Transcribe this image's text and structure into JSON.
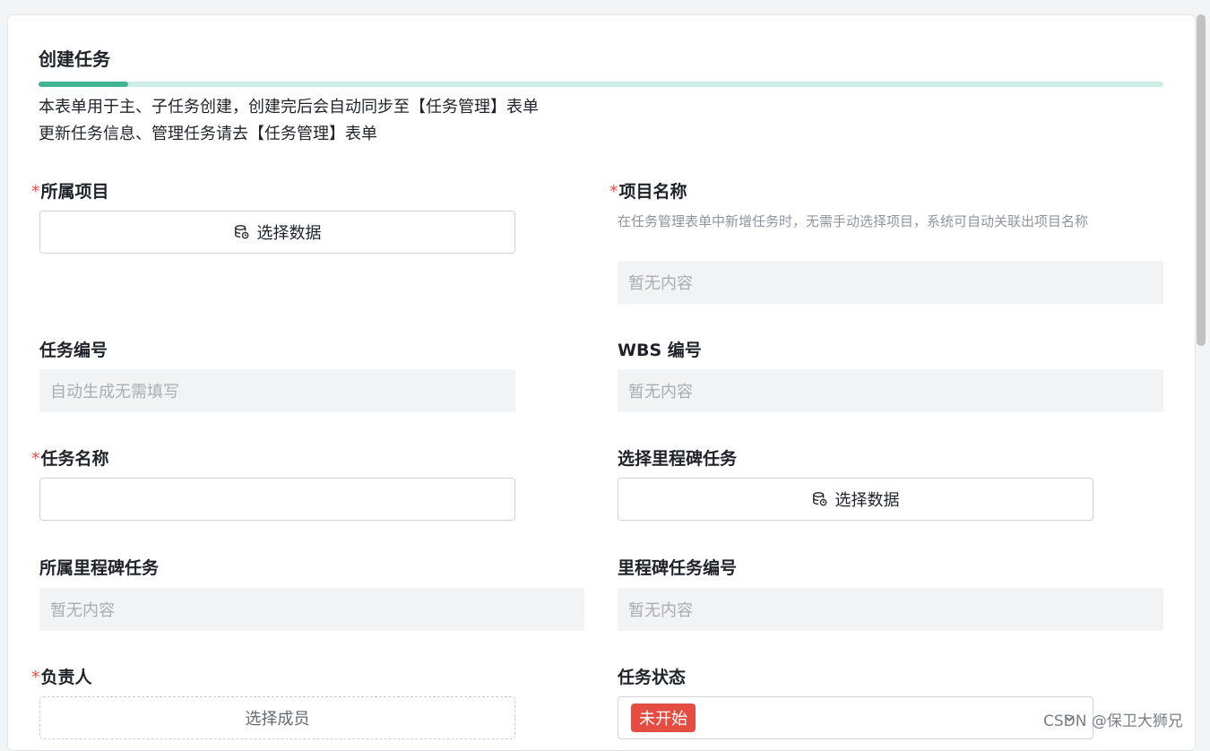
{
  "section": {
    "title": "创建任务",
    "progress_fraction": 0.08,
    "description_lines": [
      "本表单用于主、子任务创建，创建完后会自动同步至【任务管理】表单",
      "更新任务信息、管理任务请去【任务管理】表单"
    ]
  },
  "required_marker": "*",
  "fields": {
    "project": {
      "label": "所属项目",
      "button_label": "选择数据",
      "icon": "database-icon"
    },
    "project_name": {
      "label": "项目名称",
      "hint": "在任务管理表单中新增任务时，无需手动选择项目，系统可自动关联出项目名称",
      "value": "暂无内容"
    },
    "task_number": {
      "label": "任务编号",
      "value": "自动生成无需填写"
    },
    "wbs_number": {
      "label": "WBS 编号",
      "value": "暂无内容"
    },
    "task_name": {
      "label": "任务名称",
      "value": ""
    },
    "milestone_select": {
      "label": "选择里程碑任务",
      "button_label": "选择数据",
      "icon": "database-icon"
    },
    "parent_milestone": {
      "label": "所属里程碑任务",
      "value": "暂无内容"
    },
    "milestone_number": {
      "label": "里程碑任务编号",
      "value": "暂无内容"
    },
    "owner": {
      "label": "负责人",
      "button_label": "选择成员"
    },
    "task_status": {
      "label": "任务状态",
      "value": "未开始",
      "tag_color": "#e54d42"
    }
  },
  "watermark": "CSDN @保卫大狮兄",
  "colors": {
    "accent": "#43b493",
    "accent_light": "#cdeee7",
    "required": "#f54a45"
  }
}
